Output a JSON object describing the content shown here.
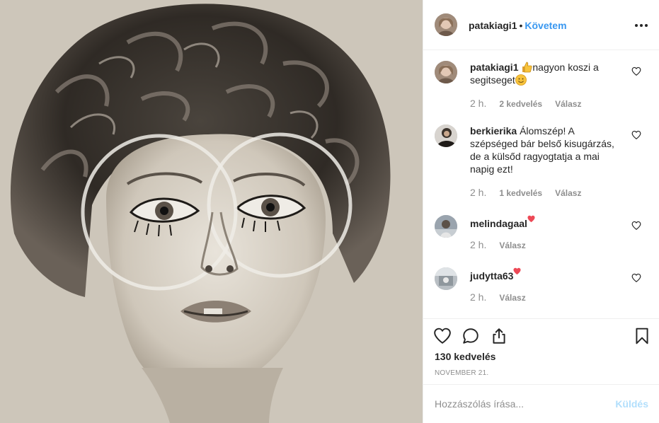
{
  "post": {
    "username": "patakiagi1",
    "separator": "•",
    "follow_label": "Követem",
    "more_icon": "more-horizontal-icon"
  },
  "comments": [
    {
      "username": "patakiagi1",
      "text_before": "",
      "emoji_1": "thumbs-up-emoji",
      "text": "nagyon koszi a segitseget",
      "emoji_2": "smile-emoji",
      "time": "2 h.",
      "likes": "2 kedvelés",
      "reply": "Válasz"
    },
    {
      "username": "berkierika",
      "text": "Álomszép! A szépséged bár belső kisugárzás, de a külsőd ragyogtatja a mai napig ezt!",
      "time": "2 h.",
      "likes": "1 kedvelés",
      "reply": "Válasz"
    },
    {
      "username": "melindagaal",
      "emoji": "red-heart-emoji",
      "time": "2 h.",
      "reply": "Válasz"
    },
    {
      "username": "judytta63",
      "emoji": "red-heart-emoji",
      "time": "2 h.",
      "reply": "Válasz"
    }
  ],
  "actions": {
    "icons": [
      "heart-icon",
      "comment-icon",
      "share-icon",
      "bookmark-icon"
    ],
    "likes_count": "130 kedvelés",
    "date": "NOVEMBER 21."
  },
  "comment_box": {
    "placeholder": "Hozzászólás írása...",
    "send_label": "Küldés"
  },
  "colors": {
    "accent": "#3897f0",
    "send_disabled": "#b2dffc",
    "heart_red": "#ed4956",
    "meta_gray": "#8e8e8e",
    "text": "#262626"
  }
}
